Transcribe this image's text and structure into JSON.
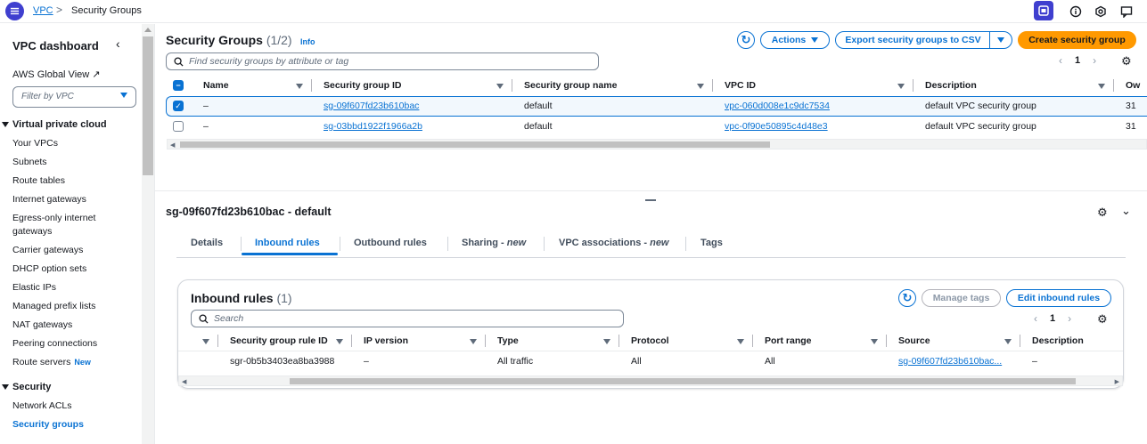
{
  "breadcrumb": {
    "root": "VPC",
    "separator": ">",
    "current": "Security Groups"
  },
  "sidebar": {
    "title": "VPC dashboard",
    "global_view": "AWS Global View ↗",
    "filter_placeholder": "Filter by VPC",
    "section_vpc": "Virtual private cloud",
    "vpc_items": [
      "Your VPCs",
      "Subnets",
      "Route tables",
      "Internet gateways",
      "Egress-only internet",
      "gateways",
      "Carrier gateways",
      "DHCP option sets",
      "Elastic IPs",
      "Managed prefix lists",
      "NAT gateways",
      "Peering connections",
      "Route servers"
    ],
    "new_badge": "New",
    "section_security": "Security",
    "security_items": [
      "Network ACLs",
      "Security groups"
    ]
  },
  "header": {
    "title": "Security Groups",
    "count": "(1/2)",
    "info": "Info",
    "actions": "Actions",
    "export": "Export security groups to CSV",
    "create": "Create security group",
    "search_placeholder": "Find security groups by attribute or tag",
    "page": "1"
  },
  "table": {
    "columns": [
      "Name",
      "Security group ID",
      "Security group name",
      "VPC ID",
      "Description",
      "Ow"
    ],
    "rows": [
      {
        "name": "–",
        "id": "sg-09f607fd23b610bac",
        "group_name": "default",
        "vpc": "vpc-060d008e1c9dc7534",
        "description": "default VPC security group",
        "owner": "31",
        "selected": true
      },
      {
        "name": "–",
        "id": "sg-03bbd1922f1966a2b",
        "group_name": "default",
        "vpc": "vpc-0f90e50895c4d48e3",
        "description": "default VPC security group",
        "owner": "31",
        "selected": false
      }
    ]
  },
  "detail": {
    "title": "sg-09f607fd23b610bac - default",
    "tabs": [
      "Details",
      "Inbound rules",
      "Outbound rules",
      "Sharing - ",
      "VPC associations - ",
      "Tags"
    ],
    "tab_new": "new"
  },
  "inbound": {
    "title": "Inbound rules",
    "count": "(1)",
    "manage_tags": "Manage tags",
    "edit": "Edit inbound rules",
    "search_placeholder": "Search",
    "page": "1",
    "columns": [
      "Security group rule ID",
      "IP version",
      "Type",
      "Protocol",
      "Port range",
      "Source",
      "Description"
    ],
    "row": {
      "rule_id": "sgr-0b5b3403ea8ba3988",
      "ip_version": "–",
      "type": "All traffic",
      "protocol": "All",
      "port_range": "All",
      "source": "sg-09f607fd23b610bac...",
      "description": "–"
    }
  },
  "colors": {
    "accent": "#0972d3",
    "primary": "#ff9900",
    "brand": "#3f3fcf"
  }
}
